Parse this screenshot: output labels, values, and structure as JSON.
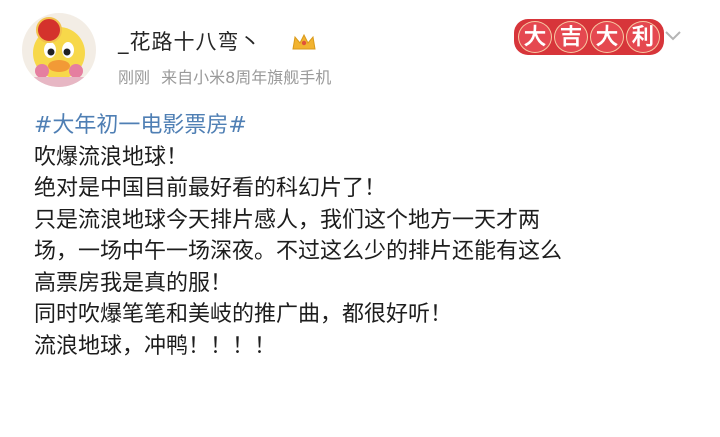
{
  "post": {
    "username": "_花路十八弯丶",
    "time": "刚刚",
    "source": "来自小米8周年旗舰手机",
    "badge_chars": [
      "大",
      "吉",
      "大",
      "利"
    ],
    "topic": "#大年初一电影票房#",
    "lines": [
      "吹爆流浪地球！",
      "绝对是中国目前最好看的科幻片了！",
      "只是流浪地球今天排片感人，我们这个地方一天才两",
      "场，一场中午一场深夜。不过这么少的排片还能有这么",
      "高票房我是真的服！",
      "同时吹爆笔笔和美岐的推广曲，都很好听！",
      "流浪地球，冲鸭！！！！"
    ]
  },
  "icons": {
    "avatar": "duck-avatar-icon",
    "vip": "crown-icon",
    "more": "chevron-down-icon"
  },
  "colors": {
    "topic": "#4f7fb4",
    "badge": "#d7353a",
    "meta": "#9a9a9a"
  }
}
